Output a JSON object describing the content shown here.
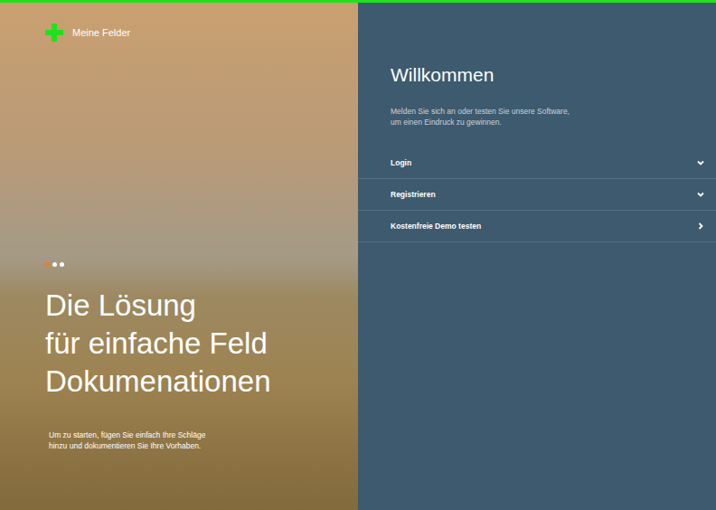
{
  "brand": {
    "name": "Meine Felder"
  },
  "hero": {
    "slides": [
      {
        "selected": true
      },
      {
        "selected": false
      },
      {
        "selected": false
      }
    ],
    "headline": [
      "Die Lösung",
      "für einfache Feld",
      "Dokumenationen"
    ],
    "text": [
      "Um zu starten, fügen Sie einfach Ihre Schläge",
      "hinzu und dokumentieren Sie Ihre Vorhaben."
    ]
  },
  "welcome": {
    "title": "Willkommen",
    "text": [
      "Melden Sie sich an oder testen Sie unsere Software,",
      "um einen Eindruck zu gewinnen."
    ]
  },
  "menu": [
    {
      "label": "Login",
      "kind": "expand",
      "expanded": false
    },
    {
      "label": "Registrieren",
      "kind": "expand",
      "expanded": false
    },
    {
      "label": "Kostenfreie Demo testen",
      "kind": "link",
      "expanded": false
    }
  ]
}
